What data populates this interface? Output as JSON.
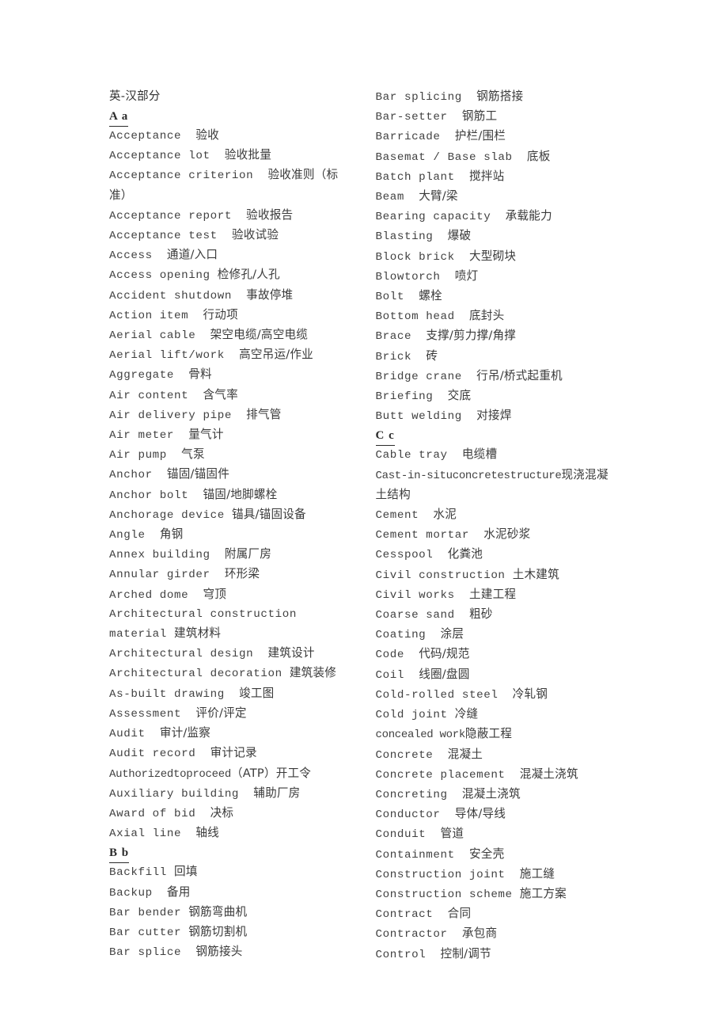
{
  "document": {
    "title": "英-汉部分",
    "columns": [
      {
        "id": "left-column",
        "blocks": [
          {
            "type": "letter",
            "label": "A a"
          },
          {
            "type": "entry",
            "en": "Acceptance",
            "gap": "  ",
            "zh": "验收"
          },
          {
            "type": "entry",
            "en": "Acceptance lot",
            "gap": "  ",
            "zh": "验收批量"
          },
          {
            "type": "entry",
            "en": "Acceptance criterion",
            "gap": "  ",
            "zh": "验收准则（标准）"
          },
          {
            "type": "entry",
            "en": "Acceptance report",
            "gap": "  ",
            "zh": "验收报告"
          },
          {
            "type": "entry",
            "en": "Acceptance test",
            "gap": "  ",
            "zh": "验收试验"
          },
          {
            "type": "entry",
            "en": "Access",
            "gap": "  ",
            "zh": "通道/入口"
          },
          {
            "type": "entry",
            "en": "Access opening",
            "gap": " ",
            "zh": "检修孔/人孔"
          },
          {
            "type": "entry",
            "en": "Accident shutdown",
            "gap": "  ",
            "zh": "事故停堆"
          },
          {
            "type": "entry",
            "en": "Action item",
            "gap": "  ",
            "zh": "行动项"
          },
          {
            "type": "entry",
            "en": "Aerial cable",
            "gap": "  ",
            "zh": "架空电缆/高空电缆"
          },
          {
            "type": "entry",
            "en": "Aerial lift/work",
            "gap": "  ",
            "zh": "高空吊运/作业"
          },
          {
            "type": "entry",
            "en": "Aggregate",
            "gap": "  ",
            "zh": "骨料"
          },
          {
            "type": "entry",
            "en": "Air content",
            "gap": "  ",
            "zh": "含气率"
          },
          {
            "type": "entry",
            "en": "Air delivery pipe",
            "gap": "  ",
            "zh": "排气管"
          },
          {
            "type": "entry",
            "en": "Air meter",
            "gap": "  ",
            "zh": "量气计"
          },
          {
            "type": "entry",
            "en": "Air pump",
            "gap": "  ",
            "zh": "气泵"
          },
          {
            "type": "entry",
            "en": "Anchor",
            "gap": "  ",
            "zh": "锚固/锚固件"
          },
          {
            "type": "entry",
            "en": "Anchor bolt",
            "gap": "  ",
            "zh": "锚固/地脚螺栓"
          },
          {
            "type": "entry",
            "en": "Anchorage device",
            "gap": " ",
            "zh": "锚具/锚固设备"
          },
          {
            "type": "entry",
            "en": "Angle",
            "gap": "  ",
            "zh": "角钢"
          },
          {
            "type": "entry",
            "en": "Annex building",
            "gap": "  ",
            "zh": "附属厂房"
          },
          {
            "type": "entry",
            "en": "Annular girder",
            "gap": "  ",
            "zh": "环形梁"
          },
          {
            "type": "entry",
            "en": "Arched dome",
            "gap": "  ",
            "zh": "穹顶"
          },
          {
            "type": "entry",
            "en": "Architectural construction material",
            "gap": " ",
            "zh": "建筑材料"
          },
          {
            "type": "entry",
            "en": "Architectural design",
            "gap": "  ",
            "zh": "建筑设计"
          },
          {
            "type": "entry",
            "en": "Architectural decoration",
            "gap": " ",
            "zh": "建筑装修"
          },
          {
            "type": "entry",
            "en": "As-built drawing",
            "gap": "  ",
            "zh": "竣工图"
          },
          {
            "type": "entry",
            "en": "Assessment",
            "gap": "  ",
            "zh": "评价/评定"
          },
          {
            "type": "entry",
            "en": "Audit",
            "gap": "  ",
            "zh": "审计/监察"
          },
          {
            "type": "entry",
            "en": "Audit record",
            "gap": "  ",
            "zh": "审计记录"
          },
          {
            "type": "entry",
            "en": "Authorizedtoproceed",
            "gap": "",
            "zh": "（ATP）开工令"
          },
          {
            "type": "entry",
            "en": "Auxiliary building",
            "gap": "  ",
            "zh": "辅助厂房"
          },
          {
            "type": "entry",
            "en": "Award of bid",
            "gap": "  ",
            "zh": "决标"
          },
          {
            "type": "entry",
            "en": "Axial line",
            "gap": "  ",
            "zh": "轴线"
          },
          {
            "type": "letter",
            "label": "B b"
          },
          {
            "type": "entry",
            "en": "Backfill",
            "gap": " ",
            "zh": "回填"
          },
          {
            "type": "entry",
            "en": "Backup",
            "gap": "  ",
            "zh": "备用"
          },
          {
            "type": "entry",
            "en": "Bar bender",
            "gap": " ",
            "zh": "钢筋弯曲机"
          },
          {
            "type": "entry",
            "en": "Bar cutter",
            "gap": " ",
            "zh": "钢筋切割机"
          },
          {
            "type": "entry",
            "en": "Bar splice",
            "gap": "  ",
            "zh": "钢筋接头"
          }
        ]
      },
      {
        "id": "right-column",
        "blocks": [
          {
            "type": "entry",
            "en": "Bar splicing",
            "gap": "  ",
            "zh": "钢筋搭接"
          },
          {
            "type": "entry",
            "en": "Bar-setter",
            "gap": "  ",
            "zh": "钢筋工"
          },
          {
            "type": "entry",
            "en": "Barricade",
            "gap": "  ",
            "zh": "护栏/围栏"
          },
          {
            "type": "entry",
            "en": "Basemat / Base slab",
            "gap": "  ",
            "zh": "底板"
          },
          {
            "type": "entry",
            "en": "Batch plant",
            "gap": "  ",
            "zh": "搅拌站"
          },
          {
            "type": "entry",
            "en": "Beam",
            "gap": "  ",
            "zh": "大臂/梁"
          },
          {
            "type": "entry",
            "en": "Bearing capacity",
            "gap": "  ",
            "zh": "承载能力"
          },
          {
            "type": "entry",
            "en": "Blasting",
            "gap": "  ",
            "zh": "爆破"
          },
          {
            "type": "entry",
            "en": "Block brick",
            "gap": "  ",
            "zh": "大型砌块"
          },
          {
            "type": "entry",
            "en": "Blowtorch",
            "gap": "  ",
            "zh": "喷灯"
          },
          {
            "type": "entry",
            "en": "Bolt",
            "gap": "  ",
            "zh": "螺栓"
          },
          {
            "type": "entry",
            "en": "Bottom head",
            "gap": "  ",
            "zh": "底封头"
          },
          {
            "type": "entry",
            "en": "Brace",
            "gap": "  ",
            "zh": "支撑/剪力撑/角撑"
          },
          {
            "type": "entry",
            "en": "Brick",
            "gap": "  ",
            "zh": "砖"
          },
          {
            "type": "entry",
            "en": "Bridge crane",
            "gap": "  ",
            "zh": "行吊/桥式起重机"
          },
          {
            "type": "entry",
            "en": "Briefing",
            "gap": "  ",
            "zh": "交底"
          },
          {
            "type": "entry",
            "en": "Butt welding",
            "gap": "  ",
            "zh": "对接焊"
          },
          {
            "type": "letter",
            "label": "C c"
          },
          {
            "type": "entry",
            "en": "Cable tray",
            "gap": "  ",
            "zh": "电缆槽"
          },
          {
            "type": "entry",
            "en": "Cast-in-situconcretestructure",
            "gap": "",
            "zh": "现浇混凝土结构"
          },
          {
            "type": "entry",
            "en": "Cement",
            "gap": "  ",
            "zh": "水泥"
          },
          {
            "type": "entry",
            "en": "Cement mortar",
            "gap": "  ",
            "zh": "水泥砂浆"
          },
          {
            "type": "entry",
            "en": "Cesspool",
            "gap": "  ",
            "zh": "化粪池"
          },
          {
            "type": "entry",
            "en": "Civil construction",
            "gap": " ",
            "zh": "土木建筑"
          },
          {
            "type": "entry",
            "en": "Civil works",
            "gap": "  ",
            "zh": "土建工程"
          },
          {
            "type": "entry",
            "en": "Coarse sand",
            "gap": "  ",
            "zh": "粗砂"
          },
          {
            "type": "entry",
            "en": "Coating",
            "gap": "  ",
            "zh": "涂层"
          },
          {
            "type": "entry",
            "en": "Code",
            "gap": "  ",
            "zh": "代码/规范"
          },
          {
            "type": "entry",
            "en": "Coil",
            "gap": "  ",
            "zh": "线圈/盘圆"
          },
          {
            "type": "entry",
            "en": "Cold-rolled steel",
            "gap": "  ",
            "zh": "冷轧钢"
          },
          {
            "type": "entry",
            "en": "Cold joint",
            "gap": " ",
            "zh": "冷缝"
          },
          {
            "type": "entry",
            "en": "concealed  work",
            "gap": "",
            "zh": "隐蔽工程"
          },
          {
            "type": "entry",
            "en": "Concrete",
            "gap": "  ",
            "zh": "混凝土"
          },
          {
            "type": "entry",
            "en": "Concrete placement",
            "gap": "  ",
            "zh": "混凝土浇筑"
          },
          {
            "type": "entry",
            "en": "Concreting",
            "gap": "  ",
            "zh": "混凝土浇筑"
          },
          {
            "type": "entry",
            "en": "Conductor",
            "gap": "  ",
            "zh": "导体/导线"
          },
          {
            "type": "entry",
            "en": "Conduit",
            "gap": "  ",
            "zh": "管道"
          },
          {
            "type": "entry",
            "en": "Containment",
            "gap": "  ",
            "zh": "安全壳"
          },
          {
            "type": "entry",
            "en": "Construction joint",
            "gap": "  ",
            "zh": "施工缝"
          },
          {
            "type": "entry",
            "en": "Construction scheme",
            "gap": " ",
            "zh": "施工方案"
          },
          {
            "type": "entry",
            "en": "Contract",
            "gap": "  ",
            "zh": "合同"
          },
          {
            "type": "entry",
            "en": "Contractor",
            "gap": "  ",
            "zh": "承包商"
          },
          {
            "type": "entry",
            "en": "Control",
            "gap": "  ",
            "zh": "控制/调节"
          }
        ]
      }
    ]
  }
}
